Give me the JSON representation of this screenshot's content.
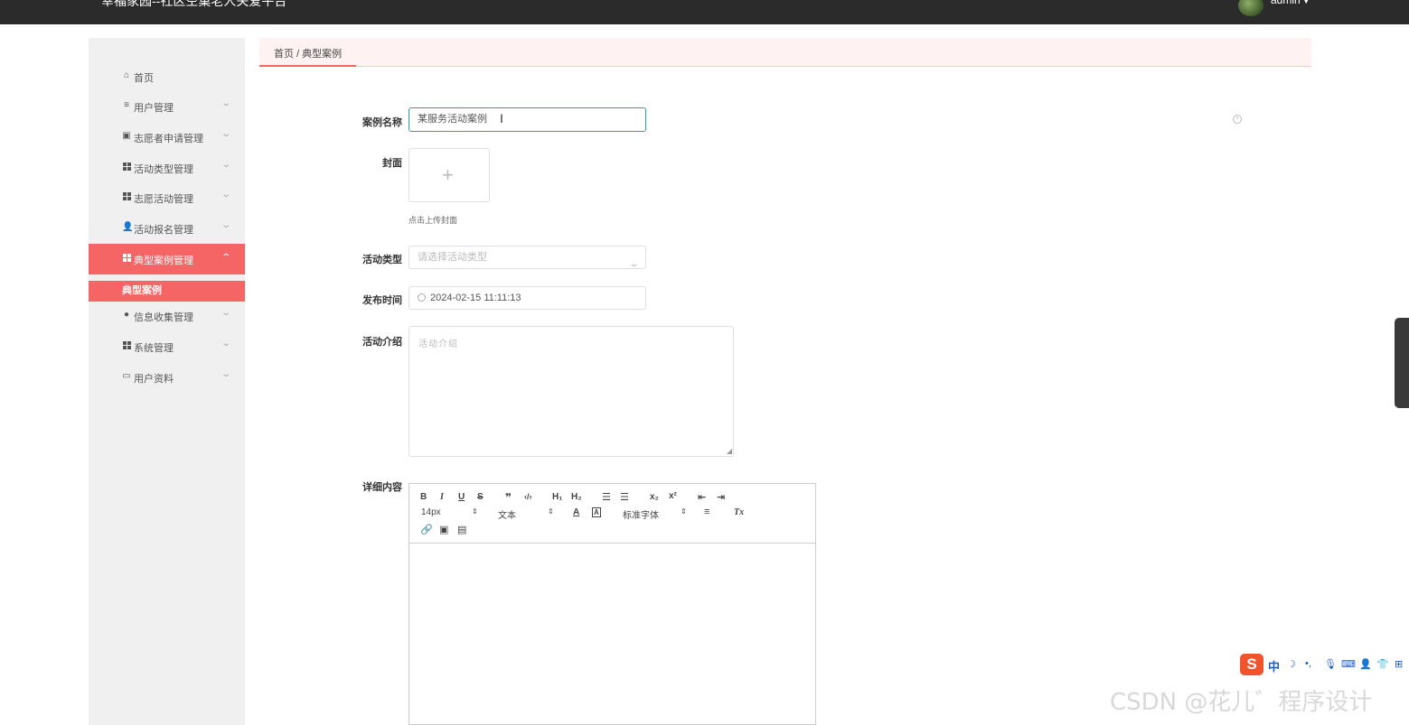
{
  "header": {
    "title": "幸福家园--社区空巢老人关爱平台",
    "username": "admin"
  },
  "sidebar": {
    "items": [
      {
        "label": "首页",
        "icon": "home-icon"
      },
      {
        "label": "用户管理",
        "icon": "list-icon"
      },
      {
        "label": "志愿者申请管理",
        "icon": "clipboard-icon"
      },
      {
        "label": "活动类型管理",
        "icon": "grid-icon"
      },
      {
        "label": "志愿活动管理",
        "icon": "grid-icon"
      },
      {
        "label": "活动报名管理",
        "icon": "user-icon"
      },
      {
        "label": "典型案例管理",
        "icon": "grid-icon"
      },
      {
        "label": "信息收集管理",
        "icon": "pin-icon"
      },
      {
        "label": "系统管理",
        "icon": "grid-icon"
      },
      {
        "label": "用户资料",
        "icon": "card-icon"
      }
    ],
    "active_submenu": "典型案例"
  },
  "breadcrumb": {
    "text": "首页 / 典型案例"
  },
  "form": {
    "name_label": "案例名称",
    "name_value": "某服务活动案例",
    "cover_label": "封面",
    "cover_hint": "点击上传封面",
    "type_label": "活动类型",
    "type_placeholder": "请选择活动类型",
    "time_label": "发布时间",
    "time_value": "2024-02-15 11:11:13",
    "intro_label": "活动介绍",
    "intro_placeholder": "活动介绍",
    "detail_label": "详细内容"
  },
  "editor": {
    "font_size": "14px",
    "header_select": "文本",
    "font_family": "标准字体"
  },
  "colors": {
    "accent": "#f56565",
    "topbar": "#2b2b2b",
    "focus": "#2aa198"
  },
  "ime": {
    "mode": "中"
  },
  "watermark": "CSDN @花儿゛程序设计"
}
